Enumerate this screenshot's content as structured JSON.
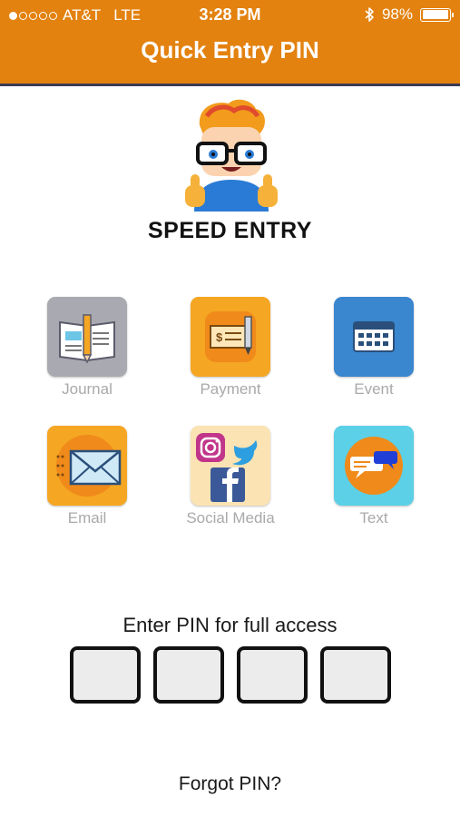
{
  "status_bar": {
    "carrier": "AT&T",
    "network": "LTE",
    "time": "3:28 PM",
    "battery": "98%",
    "battery_level": 0.98,
    "signal_bars": 1
  },
  "header": {
    "title": "Quick Entry PIN",
    "color": "#e3820f"
  },
  "brand": {
    "name": "SPEED ENTRY"
  },
  "tiles": [
    {
      "label": "Journal",
      "icon": "journal-icon",
      "color": "#a9a9b1"
    },
    {
      "label": "Payment",
      "icon": "payment-icon",
      "color": "#f5a623"
    },
    {
      "label": "Event",
      "icon": "calendar-icon",
      "color": "#3a86cf"
    },
    {
      "label": "Email",
      "icon": "envelope-icon",
      "color": "#f5a623"
    },
    {
      "label": "Social Media",
      "icon": "social-media-icon",
      "color": "#fbe3b3"
    },
    {
      "label": "Text",
      "icon": "chat-bubbles-icon",
      "color": "#5bd0e6"
    }
  ],
  "pin": {
    "label": "Enter PIN for full access",
    "digits": [
      "",
      "",
      "",
      ""
    ]
  },
  "forgot": {
    "label": "Forgot PIN?"
  }
}
